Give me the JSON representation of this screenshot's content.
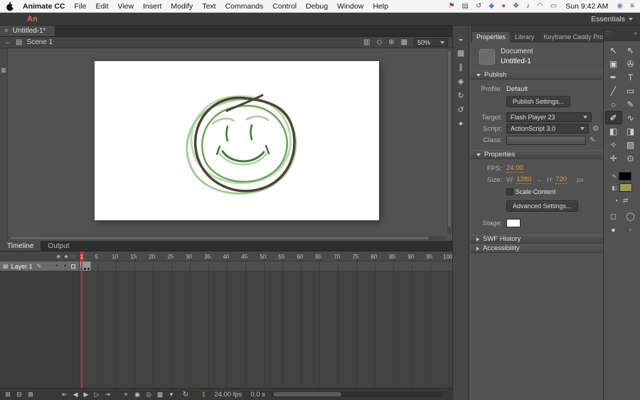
{
  "drawing": {
    "light_green": "#a3cf98",
    "mid_green": "#69a857",
    "dark_green": "#3f7a35",
    "outline": "#4b4632"
  },
  "menubar": {
    "items": [
      "Animate CC",
      "File",
      "Edit",
      "View",
      "Insert",
      "Modify",
      "Text",
      "Commands",
      "Control",
      "Debug",
      "Window",
      "Help"
    ],
    "status_icons": [
      {
        "name": "language-input-icon",
        "glyph": "⚑",
        "color": "#b33939"
      },
      {
        "name": "screen-mirroring-icon",
        "glyph": "▤",
        "color": "#555555"
      },
      {
        "name": "time-machine-icon",
        "glyph": "↺",
        "color": "#555555"
      },
      {
        "name": "dropbox-icon",
        "glyph": "◆",
        "color": "#4f7fd4"
      },
      {
        "name": "creative-cloud-icon",
        "glyph": "●",
        "color": "#d04c3e"
      },
      {
        "name": "bluetooth-icon",
        "glyph": "❖",
        "color": "#555555"
      },
      {
        "name": "volume-icon",
        "glyph": "♪",
        "color": "#555555"
      },
      {
        "name": "wifi-icon",
        "glyph": "◠",
        "color": "#555555"
      },
      {
        "name": "battery-icon",
        "glyph": "▭",
        "color": "#555555"
      }
    ],
    "clock": "Sun 9:42 AM",
    "right_icons": [
      {
        "name": "siri-icon",
        "glyph": "◉",
        "color": "#8a6fd6"
      },
      {
        "name": "notification-center-icon",
        "glyph": "≡",
        "color": "#444444"
      }
    ]
  },
  "appbar": {
    "logo": "An",
    "workspace": "Essentials"
  },
  "doc_tab": {
    "close": "×",
    "title": "Untitled-1*"
  },
  "edit_bar": {
    "back_glyph": "←",
    "scene_glyph": "▤",
    "scene_label": "Scene 1",
    "zoom": "50%",
    "icons": [
      {
        "name": "edit-scene-icon",
        "glyph": "▥"
      },
      {
        "name": "edit-symbols-icon",
        "glyph": "◇"
      },
      {
        "name": "center-stage-icon",
        "glyph": "⊕"
      },
      {
        "name": "show-frame-icon",
        "glyph": "▦"
      }
    ]
  },
  "canvas": {
    "strip_glyph": "▥"
  },
  "timeline": {
    "tabs": [
      {
        "label": "Timeline",
        "active": true
      },
      {
        "label": "Output",
        "active": false
      }
    ],
    "header_icons": [
      {
        "name": "show-hide-all-layers-icon",
        "glyph": "◉"
      },
      {
        "name": "lock-all-layers-icon",
        "glyph": "◆"
      },
      {
        "name": "outline-all-layers-icon",
        "glyph": "□"
      }
    ],
    "ruler_frames": [
      1,
      5,
      10,
      15,
      20,
      25,
      30,
      35,
      40,
      45,
      50,
      55,
      60,
      65,
      70,
      75,
      80,
      85,
      90,
      95,
      100
    ],
    "layer": {
      "type_glyph": "▤",
      "name": "Layer 1",
      "pencil_glyph": "✎",
      "dot": "•"
    },
    "keyframes": [
      1,
      2,
      3
    ],
    "controls": {
      "left_icons": [
        {
          "name": "new-layer-button",
          "glyph": "⊞"
        },
        {
          "name": "new-folder-button",
          "glyph": "⊟"
        },
        {
          "name": "delete-layer-button",
          "glyph": "⊠"
        }
      ],
      "playback": [
        {
          "name": "go-to-first-frame-button",
          "glyph": "⇤"
        },
        {
          "name": "step-back-button",
          "glyph": "◀"
        },
        {
          "name": "play-button",
          "glyph": "▶"
        },
        {
          "name": "step-forward-button",
          "glyph": "▷"
        },
        {
          "name": "go-to-last-frame-button",
          "glyph": "⇥"
        }
      ],
      "onion": [
        {
          "name": "center-frame-button",
          "glyph": "⌖"
        },
        {
          "name": "onion-skin-button",
          "glyph": "◉"
        },
        {
          "name": "onion-skin-outlines-button",
          "glyph": "◎"
        },
        {
          "name": "edit-multiple-frames-button",
          "glyph": "▦"
        },
        {
          "name": "modify-markers-button",
          "glyph": "▾"
        }
      ],
      "loop_glyph": "↻",
      "frame": "1",
      "fps": "24.00 fps",
      "time": "0.0 s"
    }
  },
  "middle_strip": {
    "icons": [
      {
        "name": "color-panel-icon",
        "glyph": "◒"
      },
      {
        "name": "swatches-panel-icon",
        "glyph": "▦"
      },
      {
        "name": "align-panel-icon",
        "glyph": "∥"
      },
      {
        "name": "info-panel-icon",
        "glyph": "◈"
      },
      {
        "name": "transform-panel-icon",
        "glyph": "↻"
      },
      {
        "name": "history-panel-icon",
        "glyph": "↺"
      },
      {
        "name": "motion-presets-panel-icon",
        "glyph": "✦"
      }
    ]
  },
  "properties": {
    "tabs": [
      {
        "label": "Properties",
        "active": true
      },
      {
        "label": "Library",
        "active": false
      },
      {
        "label": "Keyframe Caddy Pro",
        "active": false
      }
    ],
    "panel_menu_glyph": "≡",
    "document": {
      "type": "Document",
      "name": "Untitled-1"
    },
    "publish": {
      "header": "Publish",
      "profile_label": "Profile:",
      "profile_value": "Default",
      "publish_settings": "Publish Settings...",
      "target_label": "Target:",
      "target_value": "Flash Player 23",
      "script_label": "Script:",
      "script_value": "ActionScript 3.0",
      "class_label": "Class:",
      "wrench_glyph": "⚙",
      "pencil_glyph": "✎"
    },
    "props": {
      "header": "Properties",
      "fps_label": "FPS:",
      "fps_value": "24.00",
      "size_label": "Size:",
      "w_label": "W:",
      "w_value": "1280",
      "link_glyph": "⇔",
      "h_label": "H:",
      "h_value": "720",
      "px_label": "px",
      "scale_content": "Scale Content",
      "advanced_settings": "Advanced Settings...",
      "stage_label": "Stage:"
    },
    "swf_history": {
      "header": "SWF History"
    },
    "accessibility": {
      "header": "Accessibility"
    }
  },
  "tools": {
    "grip_glyph": "∷",
    "collapse_glyph": "»",
    "items": [
      {
        "name": "selection-tool",
        "glyph": "↖"
      },
      {
        "name": "subselection-tool",
        "glyph": "⇖"
      },
      {
        "name": "free-transform-tool",
        "glyph": "▣"
      },
      {
        "name": "lasso-tool",
        "glyph": "✇"
      },
      {
        "name": "pen-tool",
        "glyph": "✒"
      },
      {
        "name": "text-tool",
        "glyph": "T"
      },
      {
        "name": "line-tool",
        "glyph": "╱"
      },
      {
        "name": "rectangle-tool",
        "glyph": "▭"
      },
      {
        "name": "oval-tool",
        "glyph": "○"
      },
      {
        "name": "pencil-tool",
        "glyph": "✎"
      },
      {
        "name": "brush-tool",
        "glyph": "✐",
        "selected": true
      },
      {
        "name": "bone-tool",
        "glyph": "∿"
      },
      {
        "name": "paint-bucket-tool",
        "glyph": "◧"
      },
      {
        "name": "ink-bottle-tool",
        "glyph": "◨"
      },
      {
        "name": "eyedropper-tool",
        "glyph": "✧"
      },
      {
        "name": "eraser-tool",
        "glyph": "▨"
      },
      {
        "name": "hand-tool",
        "glyph": "✛"
      },
      {
        "name": "zoom-tool",
        "glyph": "⊙"
      }
    ],
    "swatches": {
      "stroke_glyph": "✎",
      "fill_glyph": "◧",
      "stroke_color": "#000000",
      "fill_color": "#9aa04e"
    },
    "mini": [
      {
        "name": "default-colors-icon",
        "glyph": "▪"
      },
      {
        "name": "swap-colors-icon",
        "glyph": "⇄"
      }
    ],
    "options": [
      {
        "name": "object-drawing-toggle",
        "glyph": "◻"
      },
      {
        "name": "snap-to-objects-toggle",
        "glyph": "◯"
      },
      {
        "name": "brush-mode-option",
        "glyph": "●"
      },
      {
        "name": "brush-size-option",
        "glyph": "◦"
      }
    ]
  }
}
